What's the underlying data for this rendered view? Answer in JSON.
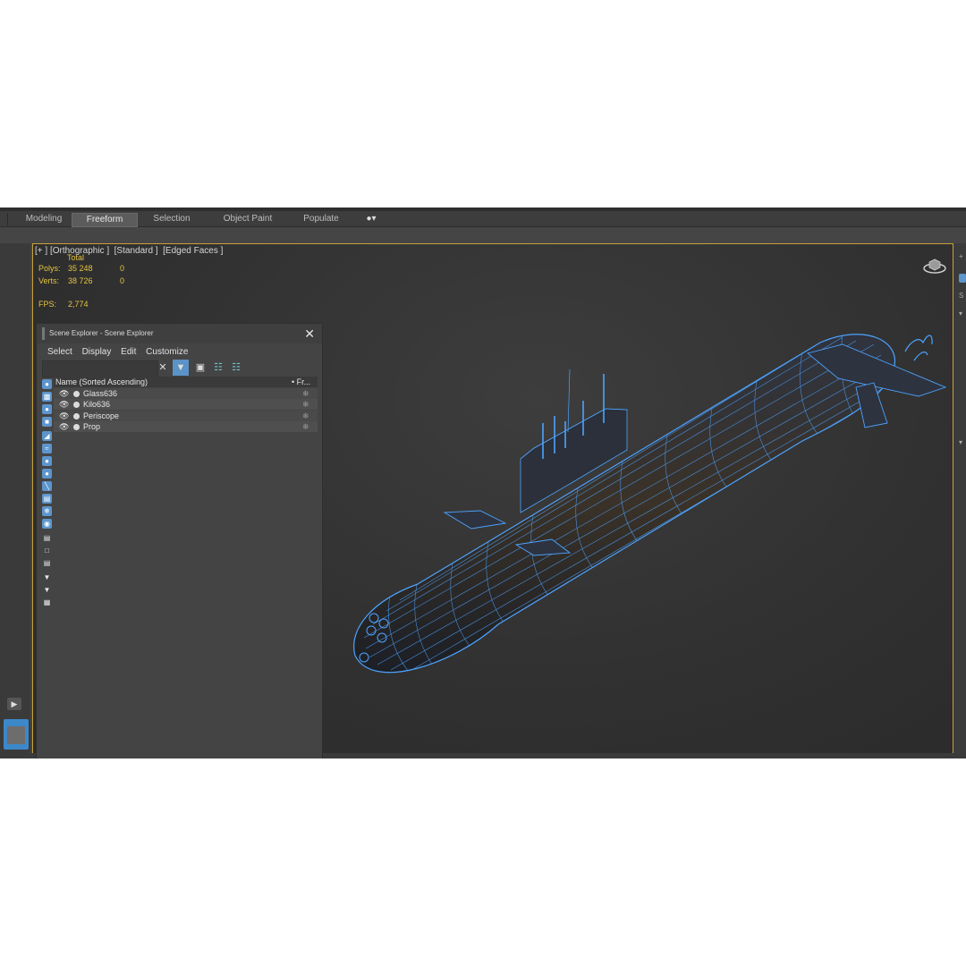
{
  "ribbon": {
    "tabs": [
      "Modeling",
      "Freeform",
      "Selection",
      "Object Paint",
      "Populate"
    ],
    "active_tab": "Freeform"
  },
  "viewport": {
    "label": "[+ ] [Orthographic ]  [Standard ]  [Edged Faces ]",
    "stats": {
      "total_label": "Total",
      "polys_label": "Polys:",
      "polys_value": "35 248",
      "polys_sel": "0",
      "verts_label": "Verts:",
      "verts_value": "38 726",
      "verts_sel": "0",
      "fps_label": "FPS:",
      "fps_value": "2,774"
    },
    "stats_color": "#e4c441",
    "border_color": "#c9a13a",
    "wireframe_color": "#4da3ff"
  },
  "scene_explorer": {
    "title": "Scene Explorer - Scene Explorer",
    "close_icon": "close-icon",
    "menu": [
      "Select",
      "Display",
      "Edit",
      "Customize"
    ],
    "search_placeholder": "",
    "column_name": "Name (Sorted Ascending)",
    "column_frozen": "• Fr...",
    "rows": [
      {
        "name": "Glass636"
      },
      {
        "name": "Kilo636"
      },
      {
        "name": "Periscope"
      },
      {
        "name": "Prop"
      }
    ]
  }
}
